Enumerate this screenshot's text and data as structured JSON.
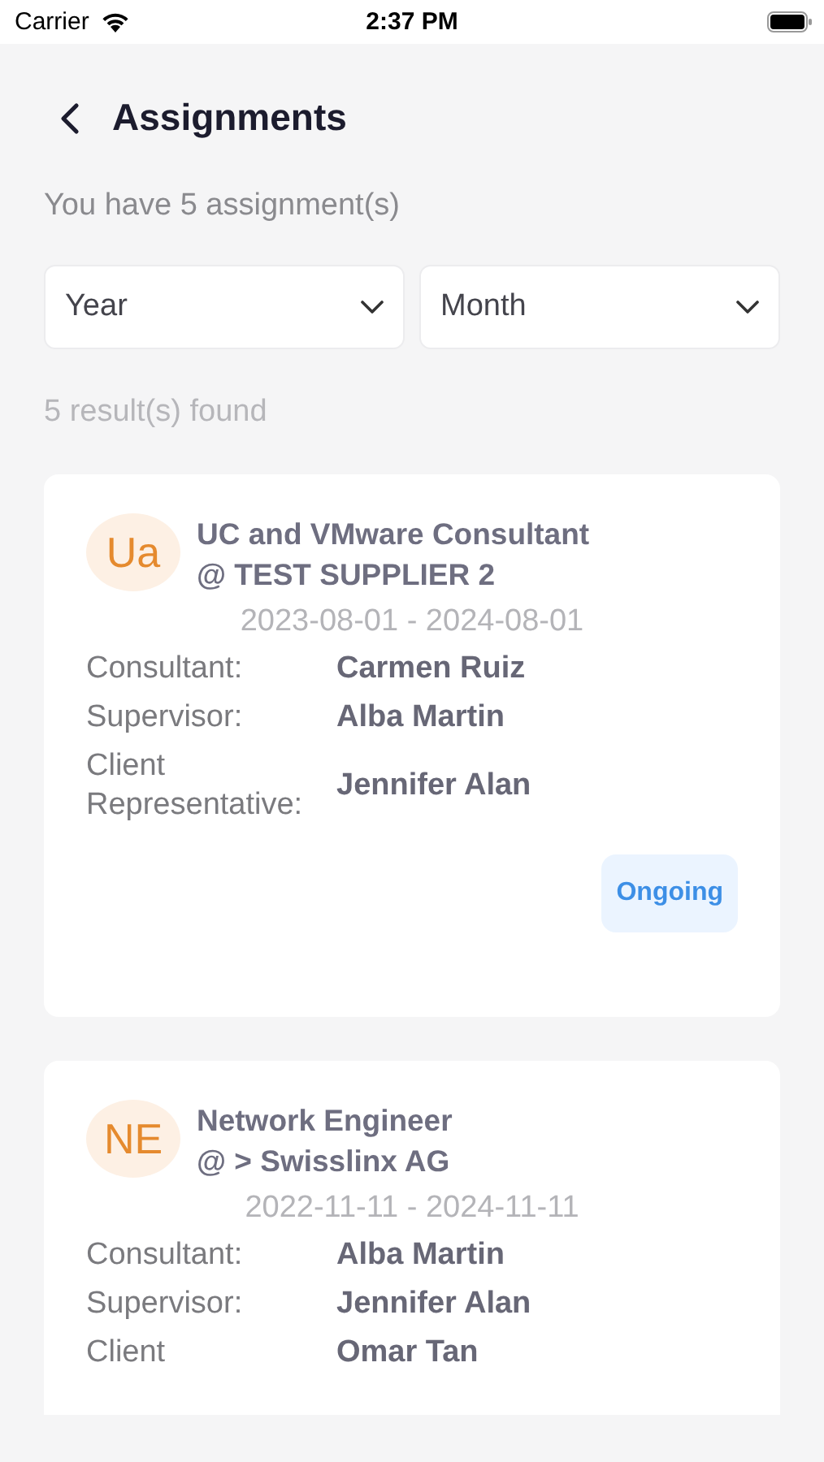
{
  "status_bar": {
    "carrier": "Carrier",
    "time": "2:37 PM"
  },
  "header": {
    "title": "Assignments"
  },
  "summary": "You have 5 assignment(s)",
  "filters": [
    {
      "label": "Year"
    },
    {
      "label": "Month"
    }
  ],
  "results": "5 result(s) found",
  "assignments": [
    {
      "initials": "Ua",
      "title": "UC and VMware Consultant",
      "company": "@ TEST SUPPLIER 2",
      "dates": "2023-08-01 - 2024-08-01",
      "fields": [
        {
          "label": "Consultant:",
          "value": "Carmen Ruiz"
        },
        {
          "label": "Supervisor:",
          "value": "Alba Martin"
        },
        {
          "label": "Client Representative:",
          "value": "Jennifer Alan"
        }
      ],
      "status": "Ongoing"
    },
    {
      "initials": "NE",
      "title": "Network Engineer",
      "company": "@ > Swisslinx AG",
      "dates": "2022-11-11 - 2024-11-11",
      "fields": [
        {
          "label": "Consultant:",
          "value": "Alba Martin"
        },
        {
          "label": "Supervisor:",
          "value": "Jennifer Alan"
        },
        {
          "label": "Client",
          "value": "Omar Tan"
        }
      ]
    }
  ]
}
